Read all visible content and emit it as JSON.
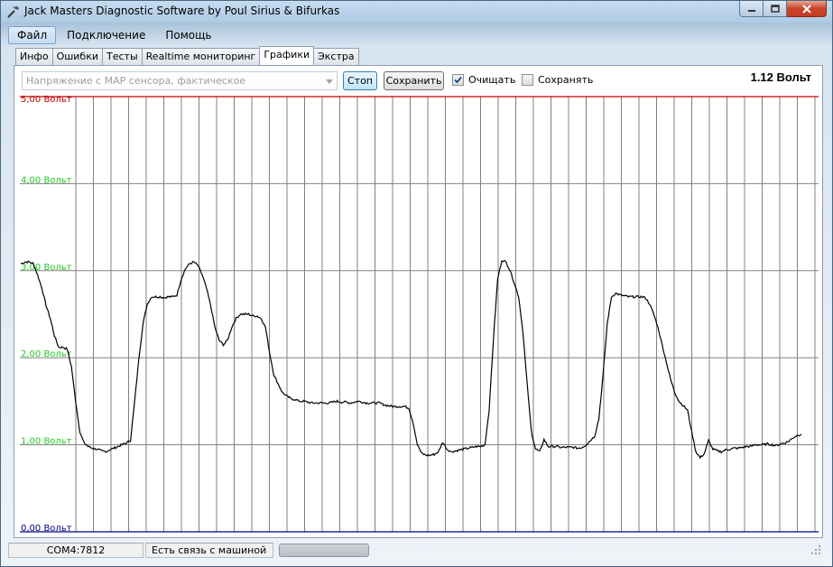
{
  "window": {
    "title": "Jack Masters Diagnostic Software by Poul Sirius & Bifurkas",
    "icon": "hammer-icon"
  },
  "menu": {
    "items": [
      {
        "label": "Файл"
      },
      {
        "label": "Подключение"
      },
      {
        "label": "Помощь"
      }
    ]
  },
  "tabs": [
    {
      "label": "Инфо"
    },
    {
      "label": "Ошибки"
    },
    {
      "label": "Тесты"
    },
    {
      "label": "Realtime мониторинг"
    },
    {
      "label": "Графики"
    },
    {
      "label": "Экстра"
    }
  ],
  "toolbar": {
    "parameter_select": "Напряжение с MAP сенсора, фактическое",
    "stop_label": "Стоп",
    "save_label": "Сохранить",
    "clear_label": "Очищать",
    "clear_checked": true,
    "keep_label": "Сохранять",
    "keep_checked": false,
    "current_value": "1.12 Вольт"
  },
  "colors": {
    "top_line": "#c00000",
    "bottom_line": "#000080",
    "grid_vertical": "#808080",
    "grid_horizontal": "#808080",
    "y_label_top": "#c00000",
    "y_label": "#22cc22",
    "y_label_bottom": "#000080",
    "trace": "#000000"
  },
  "chart_data": {
    "type": "line",
    "ylim": [
      0,
      5
    ],
    "yticks": [
      "0,00 Вольт",
      "1,00 Вольт",
      "2,00 Вольт",
      "3,00 Вольт",
      "4,00 Вольт",
      "5,00 Вольт"
    ],
    "grid": true,
    "series": [
      {
        "values": [
          3.08,
          3.1,
          3.1,
          3.08,
          2.95,
          2.8,
          2.6,
          2.45,
          2.25,
          2.12,
          2.12,
          2.1,
          1.9,
          1.5,
          1.15,
          1.02,
          0.98,
          0.96,
          0.95,
          0.93,
          0.92,
          0.94,
          0.96,
          0.98,
          1.0,
          1.02,
          1.05,
          1.5,
          2.0,
          2.4,
          2.62,
          2.7,
          2.7,
          2.7,
          2.69,
          2.7,
          2.7,
          2.72,
          2.9,
          3.02,
          3.08,
          3.1,
          3.06,
          2.95,
          2.8,
          2.6,
          2.35,
          2.2,
          2.15,
          2.2,
          2.35,
          2.45,
          2.5,
          2.5,
          2.5,
          2.48,
          2.48,
          2.45,
          2.35,
          2.05,
          1.8,
          1.7,
          1.6,
          1.56,
          1.53,
          1.52,
          1.5,
          1.5,
          1.49,
          1.48,
          1.48,
          1.48,
          1.48,
          1.48,
          1.49,
          1.5,
          1.49,
          1.49,
          1.48,
          1.49,
          1.5,
          1.49,
          1.48,
          1.48,
          1.48,
          1.48,
          1.46,
          1.45,
          1.44,
          1.44,
          1.44,
          1.44,
          1.42,
          1.25,
          1.0,
          0.9,
          0.88,
          0.88,
          0.89,
          0.92,
          1.03,
          0.95,
          0.92,
          0.93,
          0.94,
          0.95,
          0.96,
          0.97,
          0.98,
          0.98,
          1.0,
          1.4,
          2.2,
          2.9,
          3.12,
          3.1,
          3.0,
          2.85,
          2.7,
          2.3,
          1.7,
          1.15,
          0.95,
          0.92,
          1.06,
          0.98,
          0.98,
          0.98,
          0.97,
          0.97,
          0.97,
          0.97,
          0.96,
          0.97,
          1.0,
          1.05,
          1.1,
          1.3,
          1.8,
          2.4,
          2.7,
          2.74,
          2.72,
          2.71,
          2.7,
          2.7,
          2.7,
          2.7,
          2.69,
          2.62,
          2.5,
          2.35,
          2.15,
          1.95,
          1.75,
          1.6,
          1.5,
          1.45,
          1.4,
          1.15,
          0.92,
          0.85,
          0.9,
          1.05,
          0.95,
          0.93,
          0.92,
          0.94,
          0.95,
          0.96,
          0.96,
          0.97,
          0.98,
          0.98,
          1.0,
          1.0,
          1.0,
          1.01,
          1.0,
          0.99,
          1.01,
          1.02,
          1.04,
          1.08,
          1.11,
          1.12
        ]
      }
    ]
  },
  "status": {
    "port": "COM4:7812",
    "connection": "Есть связь с машиной",
    "progress": 1.0
  }
}
